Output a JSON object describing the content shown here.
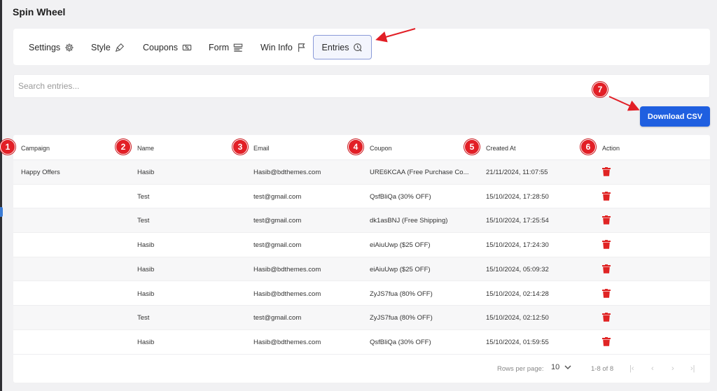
{
  "page": {
    "title": "Spin Wheel"
  },
  "tabs": [
    {
      "label": "Settings",
      "icon": "gear-icon"
    },
    {
      "label": "Style",
      "icon": "brush-icon"
    },
    {
      "label": "Coupons",
      "icon": "coupon-icon"
    },
    {
      "label": "Form",
      "icon": "form-icon"
    },
    {
      "label": "Win Info",
      "icon": "flag-icon"
    },
    {
      "label": "Entries",
      "icon": "entries-icon",
      "active": true
    }
  ],
  "search": {
    "placeholder": "Search entries..."
  },
  "download_csv": {
    "label": "Download CSV"
  },
  "table": {
    "columns": [
      "Campaign",
      "Name",
      "Email",
      "Coupon",
      "Created At",
      "Action"
    ],
    "rows": [
      {
        "campaign": "Happy Offers",
        "name": "Hasib",
        "email": "Hasib@bdthemes.com",
        "coupon": "URE6KCAA (Free Purchase Co...",
        "created_at": "21/11/2024, 11:07:55"
      },
      {
        "campaign": "",
        "name": "Test",
        "email": "test@gmail.com",
        "coupon": "QsfBliQa (30% OFF)",
        "created_at": "15/10/2024, 17:28:50"
      },
      {
        "campaign": "",
        "name": "Test",
        "email": "test@gmail.com",
        "coupon": "dk1asBNJ (Free Shipping)",
        "created_at": "15/10/2024, 17:25:54"
      },
      {
        "campaign": "",
        "name": "Hasib",
        "email": "test@gmail.com",
        "coupon": "eiAiuUwp ($25 OFF)",
        "created_at": "15/10/2024, 17:24:30"
      },
      {
        "campaign": "",
        "name": "Hasib",
        "email": "Hasib@bdthemes.com",
        "coupon": "eiAiuUwp ($25 OFF)",
        "created_at": "15/10/2024, 05:09:32"
      },
      {
        "campaign": "",
        "name": "Hasib",
        "email": "Hasib@bdthemes.com",
        "coupon": "ZyJS7fua (80% OFF)",
        "created_at": "15/10/2024, 02:14:28"
      },
      {
        "campaign": "",
        "name": "Test",
        "email": "test@gmail.com",
        "coupon": "ZyJS7fua (80% OFF)",
        "created_at": "15/10/2024, 02:12:50"
      },
      {
        "campaign": "",
        "name": "Hasib",
        "email": "Hasib@bdthemes.com",
        "coupon": "QsfBliQa (30% OFF)",
        "created_at": "15/10/2024, 01:59:55"
      }
    ],
    "delete_icon": "trash-icon"
  },
  "pagination": {
    "rows_per_page_label": "Rows per page:",
    "rows_per_page": "10",
    "range": "1-8 of 8"
  },
  "annotations": {
    "badges": [
      "1",
      "2",
      "3",
      "4",
      "5",
      "6",
      "7"
    ],
    "color": "#e21f26"
  },
  "colors": {
    "accent": "#1f5fe0",
    "danger": "#e02424",
    "active_tab_border": "#8a9ad8"
  }
}
